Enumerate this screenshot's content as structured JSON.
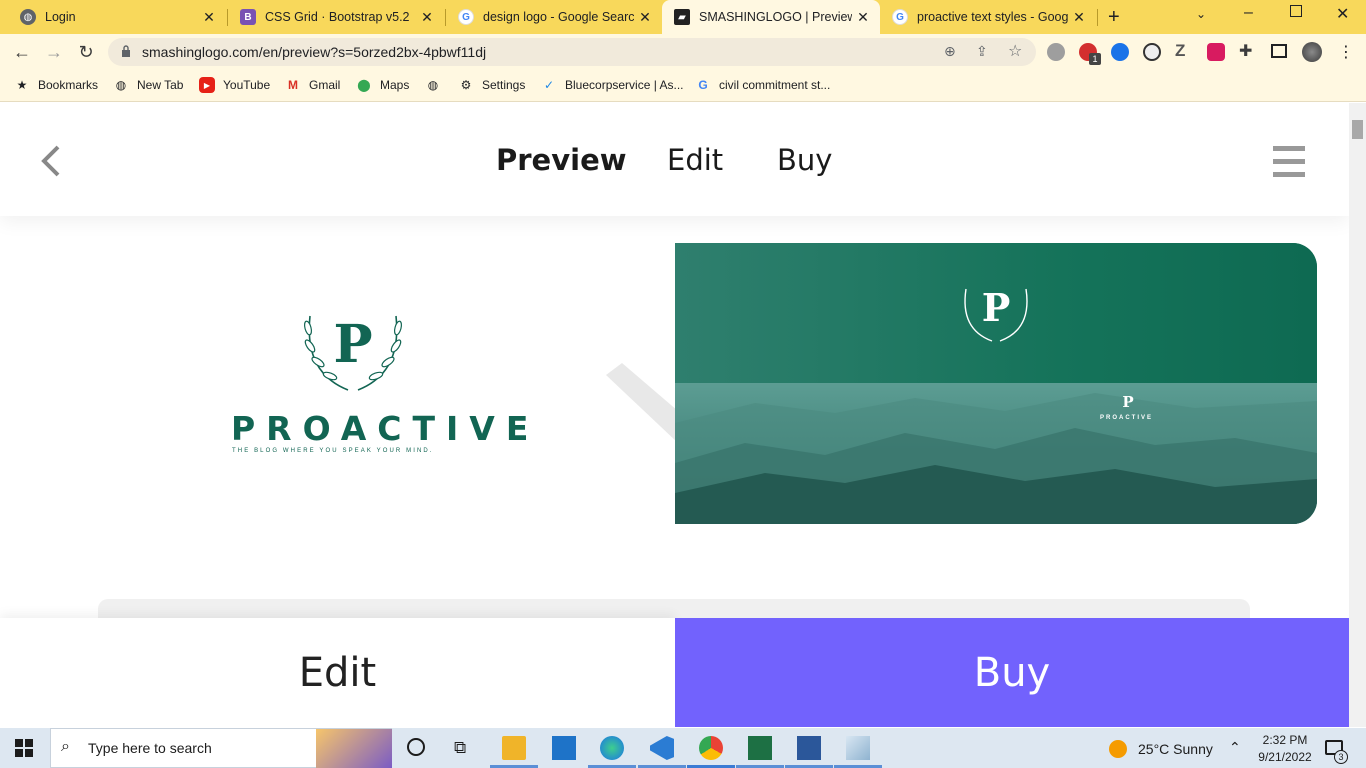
{
  "browser": {
    "tabs": [
      {
        "title": "Login",
        "favicon": "globe-icon",
        "active": false
      },
      {
        "title": "CSS Grid · Bootstrap v5.2",
        "favicon": "bootstrap-icon",
        "active": false
      },
      {
        "title": "design logo - Google Search",
        "favicon": "google-icon",
        "active": false
      },
      {
        "title": "SMASHINGLOGO | Preview",
        "favicon": "smashinglogo-icon",
        "active": true
      },
      {
        "title": "proactive text styles - Google",
        "favicon": "google-icon",
        "active": false
      }
    ],
    "url": "smashinglogo.com/en/preview?s=5orzed2bx-4pbwf11dj",
    "bookmarks": [
      {
        "label": "Bookmarks",
        "icon": "star-icon"
      },
      {
        "label": "New Tab",
        "icon": "globe-icon"
      },
      {
        "label": "YouTube",
        "icon": "youtube-icon"
      },
      {
        "label": "Gmail",
        "icon": "gmail-icon"
      },
      {
        "label": "Maps",
        "icon": "maps-icon"
      },
      {
        "label": "",
        "icon": "globe-icon"
      },
      {
        "label": "Settings",
        "icon": "gear-icon"
      },
      {
        "label": "Bluecorpservice | As...",
        "icon": "bluecorp-icon"
      },
      {
        "label": "civil commitment st...",
        "icon": "google-icon"
      }
    ],
    "extension_badge": "1"
  },
  "site": {
    "nav": {
      "preview": "Preview",
      "edit": "Edit",
      "buy": "Buy"
    },
    "logo": {
      "wordmark": "PROACTIVE",
      "tagline": "THE BLOG WHERE YOU SPEAK YOUR MIND.",
      "monogram": "P"
    },
    "mockup": {
      "small_wordmark": "PROACTIVE"
    },
    "bottom": {
      "edit": "Edit",
      "buy": "Buy"
    },
    "colors": {
      "brand_green": "#126553",
      "buy_purple": "#7262fd"
    }
  },
  "taskbar": {
    "search_placeholder": "Type here to search",
    "weather": "25°C  Sunny",
    "time": "2:32 PM",
    "date": "9/21/2022",
    "notification_count": "3"
  }
}
